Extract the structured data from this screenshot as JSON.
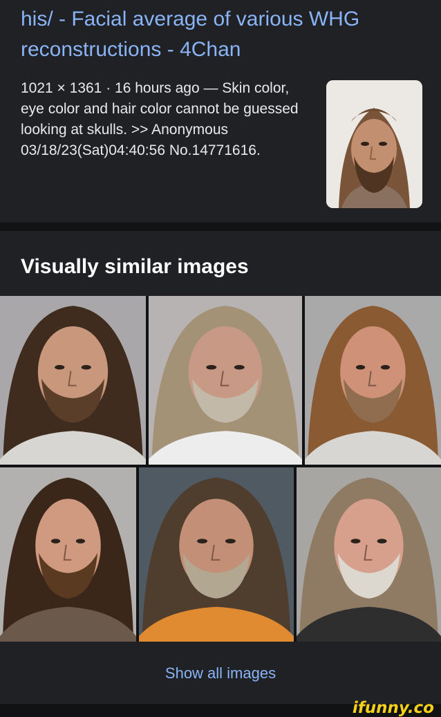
{
  "result": {
    "title": "his/ - Facial average of various WHG reconstructions - 4Chan",
    "snippet": "1021 × 1361 · 16 hours ago — Skin color, eye color and hair color cannot be guessed looking at skulls. >> Anonymous 03/18/23(Sat)04:40:56 No.14771616.",
    "thumbnail": "facial-average-portrait"
  },
  "similar": {
    "heading": "Visually similar images",
    "images": [
      {
        "name": "similar-image-1",
        "hair": "#3f2c1f",
        "beard": "#5a3e2a",
        "skin": "#c9987c",
        "bg": "#a9a7a9",
        "shirt": "#d8d6d3"
      },
      {
        "name": "similar-image-2",
        "hair": "#a49277",
        "beard": "#c2b9a8",
        "skin": "#c89a85",
        "bg": "#b8b3b3",
        "shirt": "#ededed"
      },
      {
        "name": "similar-image-3",
        "hair": "#8a5a33",
        "beard": "#8f6d4e",
        "skin": "#cf9278",
        "bg": "#a9a9a9",
        "shirt": "#d8d6d2"
      },
      {
        "name": "similar-image-4",
        "hair": "#3b271a",
        "beard": "#5b3a22",
        "skin": "#d09a80",
        "bg": "#b3b1b0",
        "shirt": "#6b5a4c"
      },
      {
        "name": "similar-image-5",
        "hair": "#4f3d2d",
        "beard": "#b2a892",
        "skin": "#c39077",
        "bg": "#4f5a62",
        "shirt": "#e08a32"
      },
      {
        "name": "similar-image-6",
        "hair": "#8f7a63",
        "beard": "#dcd8cf",
        "skin": "#d6a08c",
        "bg": "#a8a6a2",
        "shirt": "#2e2e2e"
      }
    ]
  },
  "show_all_label": "Show all images",
  "watermark": "ifunny.co"
}
